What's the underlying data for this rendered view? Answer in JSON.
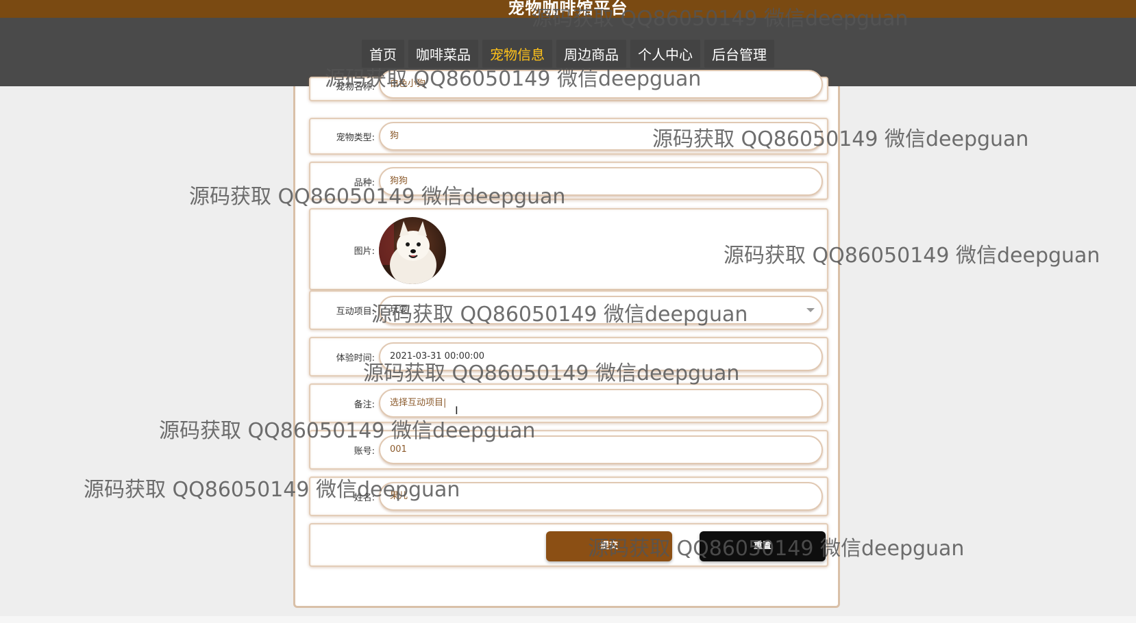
{
  "header": {
    "site_title": "宠物咖啡馆平台"
  },
  "nav": {
    "items": [
      {
        "label": "首页",
        "active": false
      },
      {
        "label": "咖啡菜品",
        "active": false
      },
      {
        "label": "宠物信息",
        "active": true
      },
      {
        "label": "周边商品",
        "active": false
      },
      {
        "label": "个人中心",
        "active": false
      },
      {
        "label": "后台管理",
        "active": false
      }
    ],
    "active_color": "#ffc21a",
    "bar_color": "#4a4a4a",
    "top_color": "#7a4a12"
  },
  "form": {
    "pet_name": {
      "label": "宠物名称:",
      "value": "白色小狗"
    },
    "pet_type": {
      "label": "宠物类型:",
      "value": "狗"
    },
    "breed": {
      "label": "品种:",
      "value": "狗狗"
    },
    "image": {
      "label": "图片:",
      "icon": "dog-photo"
    },
    "interaction": {
      "label": "互动项目:",
      "value": "玩耍",
      "icon": "chevron-down-icon"
    },
    "experience_time": {
      "label": "体验时间:",
      "value": "2021-03-31 00:00:00"
    },
    "remark": {
      "label": "备注:",
      "value": "选择互动项目|"
    },
    "account": {
      "label": "账号:",
      "value": "001"
    },
    "name": {
      "label": "姓名:",
      "value": "果儿"
    },
    "submit_label": "提交",
    "reset_label": "重置",
    "submit_color": "#8b4f14",
    "reset_color": "#0e0e0e"
  },
  "watermark_text": "源码获取 QQ86050149 微信deepguan"
}
